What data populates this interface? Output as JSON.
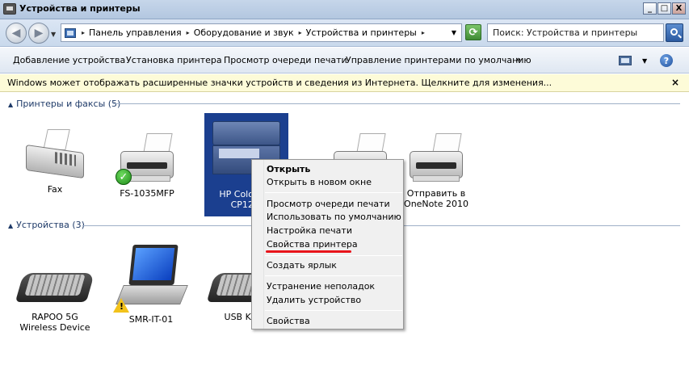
{
  "window": {
    "title": "Устройства и принтеры",
    "controls": {
      "minimize": "_",
      "maximize": "□",
      "close": "X"
    }
  },
  "nav": {
    "breadcrumbs": [
      "Панель управления",
      "Оборудование и звук",
      "Устройства и принтеры"
    ],
    "search_placeholder": "Поиск: Устройства и принтеры"
  },
  "toolbar": {
    "items": [
      "Добавление устройства",
      "Установка принтера",
      "Просмотр очереди печати",
      "Управление принтерами по умолчанию"
    ],
    "more": "»",
    "help": "?"
  },
  "infobar": {
    "message": "Windows может отображать расширенные значки устройств и сведения из Интернета.  Щелкните для изменения...",
    "close": "×"
  },
  "groups": {
    "printers": {
      "header": "Принтеры и факсы (5)",
      "items": [
        {
          "label": "Fax"
        },
        {
          "label": "FS-1035MFP",
          "badge": "default-check"
        },
        {
          "label": "HP Color L... CP12...",
          "selected": true
        },
        {
          "label": ""
        },
        {
          "label": "Отправить в OneNote 2010"
        }
      ]
    },
    "devices": {
      "header": "Устройства (3)",
      "items": [
        {
          "label": "RAPOO 5G Wireless Device"
        },
        {
          "label": "SMR-IT-01",
          "badge": "warning"
        },
        {
          "label": "USB Key..."
        }
      ]
    }
  },
  "context_menu": {
    "items": [
      "Открыть",
      "Открыть в новом окне",
      "Просмотр очереди печати",
      "Использовать по умолчанию",
      "Настройка печати",
      "Свойства принтера",
      "Создать ярлык",
      "Устранение неполадок",
      "Удалить устройство",
      "Свойства"
    ],
    "highlight_color": "#e8141b"
  },
  "colors": {
    "selection": "#1b3f8f",
    "infobar_bg": "#fdfbd8",
    "group_header": "#1e3a68"
  }
}
